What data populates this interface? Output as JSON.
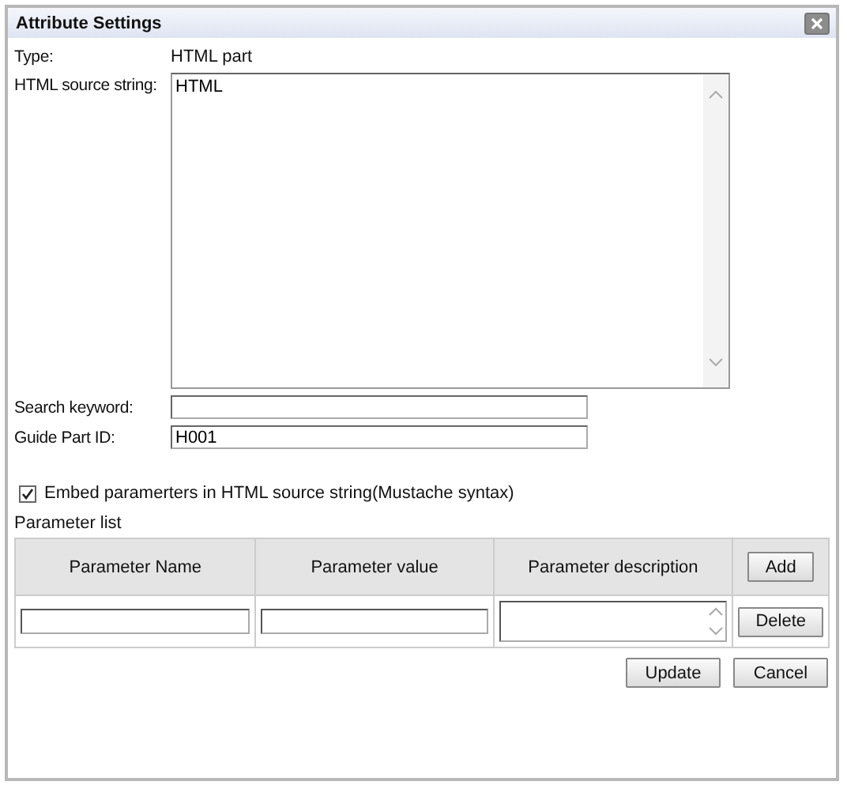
{
  "dialog": {
    "title": "Attribute Settings"
  },
  "fields": [
    {
      "kind": "static",
      "label": "Type:",
      "value": "HTML part"
    },
    {
      "kind": "textarea",
      "label": "HTML source string:",
      "value": "HTML"
    },
    {
      "kind": "input",
      "label": "Search keyword:"
    },
    {
      "kind": "input",
      "label": "Guide Part ID:",
      "value": "H001"
    }
  ],
  "embed_option": {
    "label": "Embed paramerters in HTML source string(Mustache syntax)",
    "checked": true
  },
  "parameter_list": {
    "title": "Parameter list",
    "columns": [
      "Parameter Name",
      "Parameter value",
      "Parameter description"
    ],
    "add_button": "Add",
    "delete_button": "Delete"
  },
  "buttons": [
    "Update",
    "Cancel"
  ]
}
